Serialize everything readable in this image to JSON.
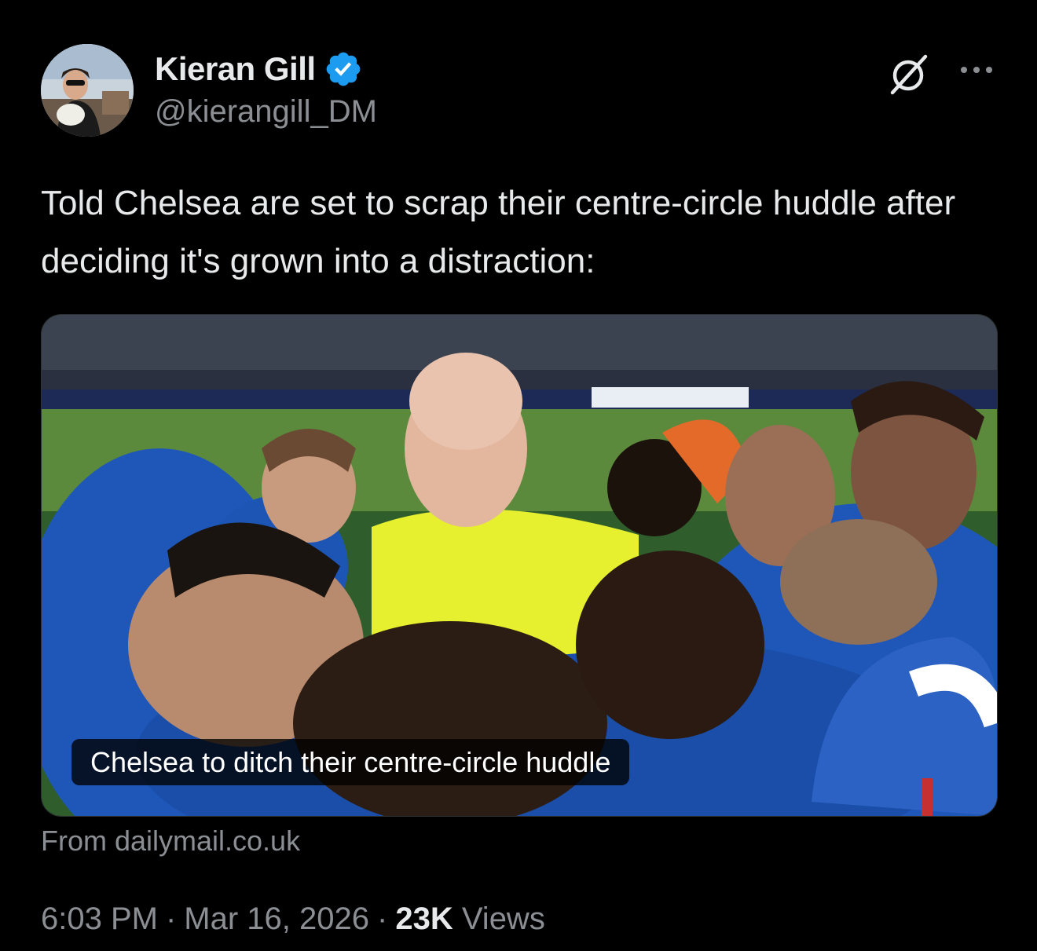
{
  "author": {
    "display_name": "Kieran Gill",
    "handle": "@kierangill_DM",
    "verified": true,
    "verified_color": "#1d9bf0",
    "avatar_icon": "avatar-photo"
  },
  "actions": {
    "grok_icon": "grok-icon",
    "more_icon": "more-dots-icon"
  },
  "tweet": {
    "text": "Told Chelsea are set to scrap their centre-circle huddle after deciding it's grown into a distraction:"
  },
  "link_card": {
    "title": "Chelsea to ditch their centre-circle huddle",
    "source": "From dailymail.co.uk"
  },
  "meta": {
    "time": "6:03 PM",
    "separator": "·",
    "date": "Mar 16, 2026",
    "views_count": "23K",
    "views_label": "Views"
  },
  "colors": {
    "background": "#000000",
    "text_primary": "#e7e9ea",
    "text_secondary": "#8b8f94",
    "verified_blue": "#1d9bf0"
  }
}
